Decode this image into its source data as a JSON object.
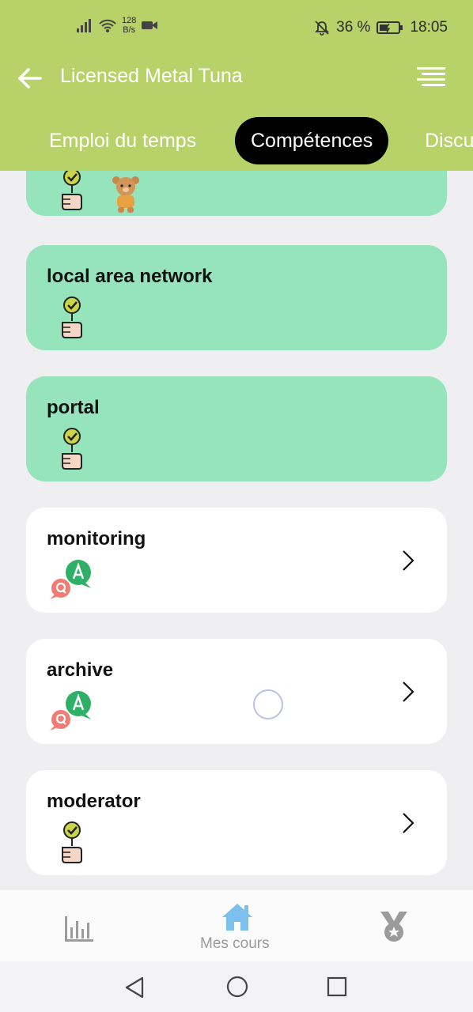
{
  "status_bar": {
    "net_speed_value": "128",
    "net_speed_unit": "B/s",
    "battery": "36 %",
    "time": "18:05"
  },
  "app_bar": {
    "title": "Licensed Metal Tuna"
  },
  "tabs": [
    {
      "label": "Emploi du temps",
      "active": false
    },
    {
      "label": "Compétences",
      "active": true
    },
    {
      "label": "Discu",
      "active": false
    }
  ],
  "cards": [
    {
      "label": "",
      "style": "green",
      "icon": "competence-hand-icon",
      "extra_icon": "bear-mascot-icon",
      "chevron": false
    },
    {
      "label": "local area network",
      "style": "green",
      "icon": "competence-hand-icon",
      "chevron": false
    },
    {
      "label": "portal",
      "style": "green",
      "icon": "competence-hand-icon",
      "chevron": false
    },
    {
      "label": "monitoring",
      "style": "white",
      "icon": "qa-bubbles-icon",
      "chevron": true
    },
    {
      "label": "archive",
      "style": "white",
      "icon": "qa-bubbles-icon",
      "chevron": true
    },
    {
      "label": "moderator",
      "style": "white",
      "icon": "competence-hand-icon",
      "chevron": true
    }
  ],
  "bottom_nav": {
    "items": [
      {
        "icon": "bar-chart-icon",
        "label": ""
      },
      {
        "icon": "home-icon",
        "label": "Mes cours",
        "active": true
      },
      {
        "icon": "medal-icon",
        "label": ""
      }
    ]
  },
  "colors": {
    "app_bar": "#b8d26a",
    "green_card": "#95e4bb",
    "white_card": "#ffffff",
    "active_tab": "#000000",
    "home_icon": "#7cc0ee"
  }
}
